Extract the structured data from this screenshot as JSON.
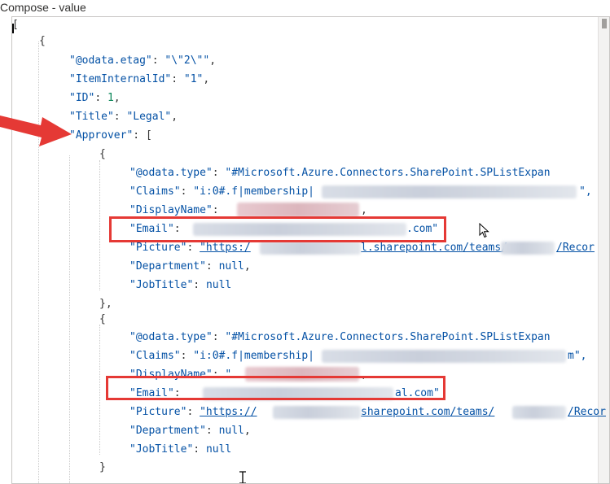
{
  "window": {
    "title": "Compose - value"
  },
  "code": {
    "open_bracket": "[",
    "obj1_open": "{",
    "etag_key": "\"@odata.etag\"",
    "etag_val": "\"\\\"2\\\"\"",
    "iid_key": "\"ItemInternalId\"",
    "iid_val": "\"1\"",
    "id_key": "\"ID\"",
    "id_val": "1",
    "title_key": "\"Title\"",
    "title_val": "\"Legal\"",
    "approver_key": "\"Approver\"",
    "approver_open": "[",
    "a1_open": "{",
    "a1_type_key": "\"@odata.type\"",
    "a1_type_val": "\"#Microsoft.Azure.Connectors.SharePoint.SPListExpan",
    "a1_claims_key": "\"Claims\"",
    "a1_claims_val": "\"i:0#.f|membership|",
    "a1_claims_tail": "\",",
    "a1_dn_key": "\"DisplayName\"",
    "a1_dn_tail": ",",
    "a1_email_key": "\"Email\"",
    "a1_email_tail": ".com\"",
    "a1_pic_key": "\"Picture\"",
    "a1_pic_pre": "\"https:/",
    "a1_pic_mid": "l.sharepoint.com/teams/",
    "a1_pic_tail": "/Recor",
    "a1_dept_key": "\"Department\"",
    "a1_dept_val": "null",
    "a1_job_key": "\"JobTitle\"",
    "a1_job_val": "null",
    "a1_close": "},",
    "a2_open": "{",
    "a2_type_key": "\"@odata.type\"",
    "a2_type_val": "\"#Microsoft.Azure.Connectors.SharePoint.SPListExpan",
    "a2_claims_key": "\"Claims\"",
    "a2_claims_val": "\"i:0#.f|membership|",
    "a2_claims_tail": "m\",",
    "a2_dn_key": "\"DisplayName\"",
    "a2_dn_pre": "\"",
    "a2_dn_tail": ",",
    "a2_email_key": "\"Email\"",
    "a2_email_tail": "al.com\"",
    "a2_pic_key": "\"Picture\"",
    "a2_pic_pre": "\"https://",
    "a2_pic_mid": "sharepoint.com/teams/",
    "a2_pic_tail": "/Recor",
    "a2_dept_key": "\"Department\"",
    "a2_dept_val": "null",
    "a2_job_key": "\"JobTitle\"",
    "a2_job_val": "null",
    "a2_close": "}",
    "colon": ": ",
    "comma": ","
  },
  "colors": {
    "key": "#0451a5",
    "number": "#098658",
    "highlight": "#e53935",
    "border": "#c8c6c4"
  }
}
